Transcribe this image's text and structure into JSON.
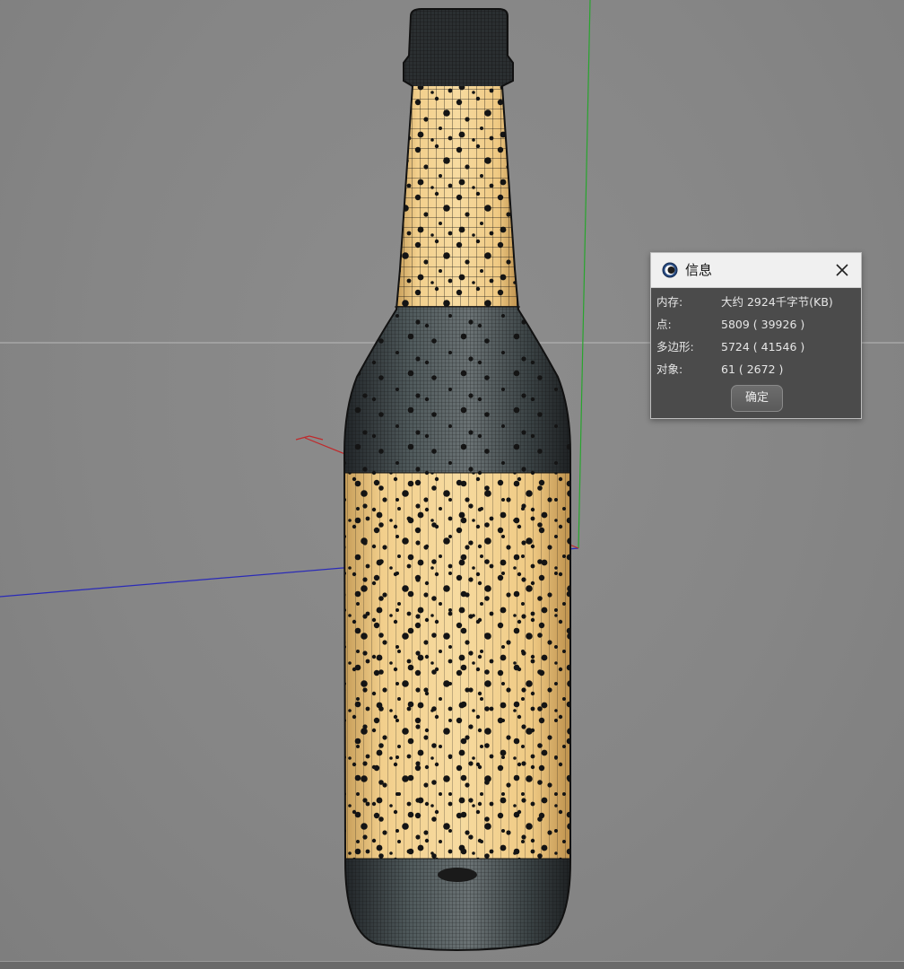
{
  "dialog": {
    "title": "信息",
    "rows": [
      {
        "label": "内存:",
        "value": "大约 2924千字节(KB)"
      },
      {
        "label": "点:",
        "value": "5809 ( 39926 )"
      },
      {
        "label": "多边形:",
        "value": "5724 ( 41546 )"
      },
      {
        "label": "对象:",
        "value": "61 ( 2672 )"
      }
    ],
    "ok_label": "确定"
  },
  "colors": {
    "viewport_bg": "#868686",
    "label_yellow": "#f0c983",
    "glass_dark": "#2f3436",
    "axis_x": "#c0282a",
    "axis_y": "#28a52e",
    "axis_z": "#2a2ab8",
    "horizon": "#b9b9b9"
  },
  "icons": {
    "app": "cinema4d-logo-icon",
    "close": "close-icon"
  }
}
